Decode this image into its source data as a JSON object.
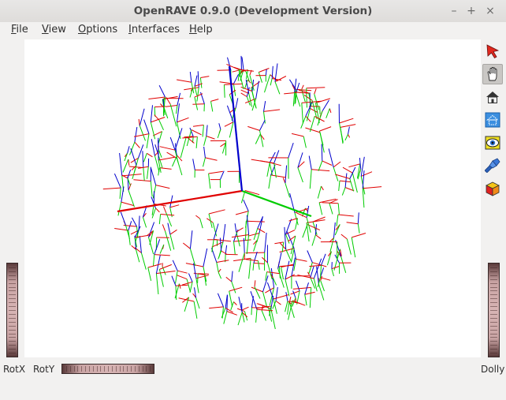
{
  "window": {
    "title": "OpenRAVE 0.9.0 (Development Version)",
    "controls": {
      "minimize": "–",
      "maximize": "+",
      "close": "×"
    }
  },
  "menubar": {
    "items": [
      {
        "mnemonic": "F",
        "rest": "ile"
      },
      {
        "mnemonic": "V",
        "rest": "iew"
      },
      {
        "mnemonic": "O",
        "rest": "ptions"
      },
      {
        "mnemonic": "I",
        "rest": "nterfaces"
      },
      {
        "mnemonic": "H",
        "rest": "elp"
      }
    ]
  },
  "toolbar": {
    "buttons": [
      {
        "icon": "select-arrow-icon",
        "active": false
      },
      {
        "icon": "hand-pan-icon",
        "active": true
      },
      {
        "icon": "home-icon",
        "active": false
      },
      {
        "icon": "set-home-icon",
        "active": false
      },
      {
        "icon": "view-all-icon",
        "active": false
      },
      {
        "icon": "seek-flashlight-icon",
        "active": false
      },
      {
        "icon": "projection-cube-icon",
        "active": false
      }
    ]
  },
  "thumbwheels": {
    "rotx_label": "RotX",
    "roty_label": "RotY",
    "dolly_label": "Dolly"
  },
  "scene": {
    "axis_colors": {
      "x": "#e00000",
      "y": "#00cc00",
      "z": "#0000cc"
    },
    "description_colors": [
      "#e00000",
      "#00cc00",
      "#0000cc"
    ]
  }
}
